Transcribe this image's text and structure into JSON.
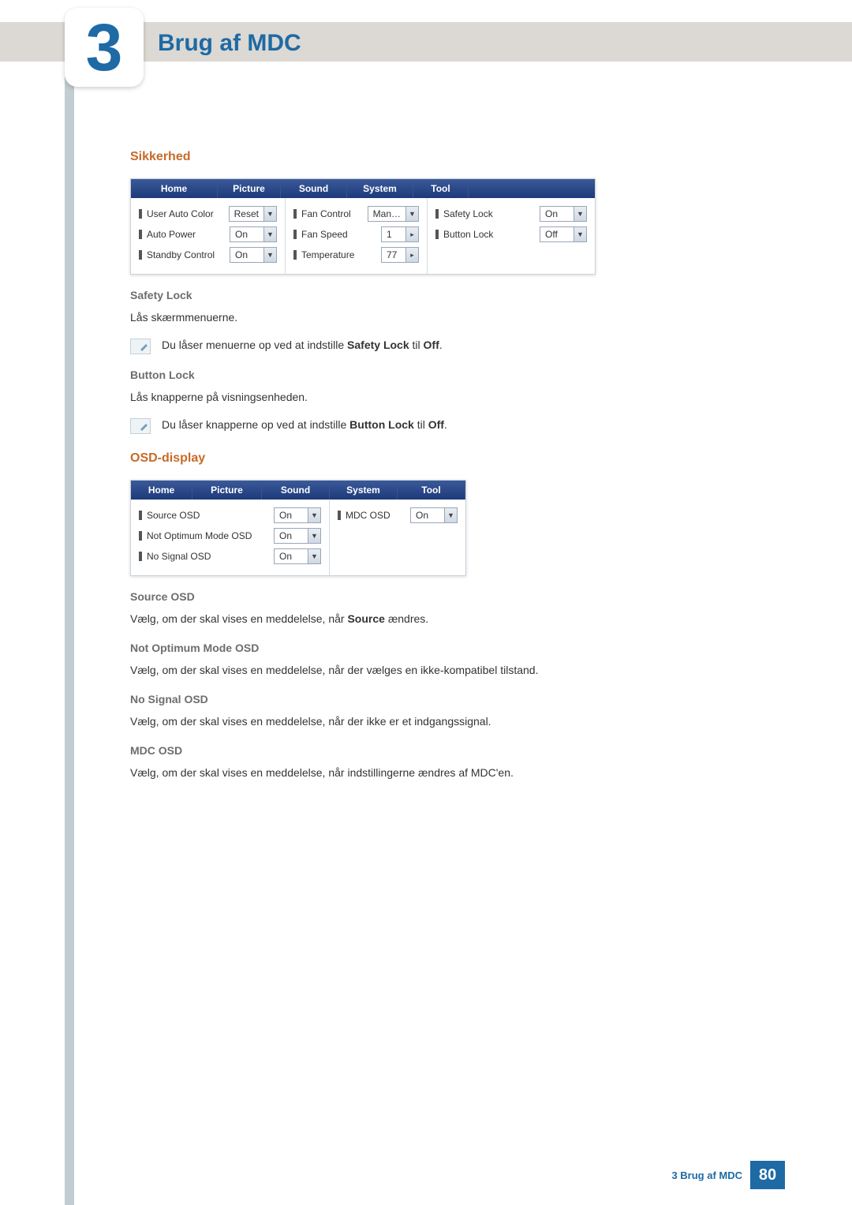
{
  "chapter": {
    "number": "3",
    "title": "Brug af MDC"
  },
  "sections": {
    "sikkerhed": {
      "title": "Sikkerhed",
      "tabs": [
        "Home",
        "Picture",
        "Sound",
        "System",
        "Tool"
      ],
      "cols": [
        {
          "fields": [
            {
              "label": "User Auto Color",
              "value": "Reset",
              "arrow": "▼"
            },
            {
              "label": "Auto Power",
              "value": "On",
              "arrow": "▼"
            },
            {
              "label": "Standby Control",
              "value": "On",
              "arrow": "▼"
            }
          ]
        },
        {
          "fields": [
            {
              "label": "Fan Control",
              "value": "Man…",
              "arrow": "▼"
            },
            {
              "label": "Fan Speed",
              "value": "1",
              "arrow": "▸"
            },
            {
              "label": "Temperature",
              "value": "77",
              "arrow": "▸"
            }
          ]
        },
        {
          "fields": [
            {
              "label": "Safety Lock",
              "value": "On",
              "arrow": "▼"
            },
            {
              "label": "Button Lock",
              "value": "Off",
              "arrow": "▼"
            }
          ]
        }
      ],
      "safety_lock": {
        "heading": "Safety Lock",
        "desc": "Lås skærmmenuerne.",
        "note_pre": "Du låser menuerne op ved at indstille ",
        "note_b1": "Safety Lock",
        "note_mid": " til ",
        "note_b2": "Off",
        "note_post": "."
      },
      "button_lock": {
        "heading": "Button Lock",
        "desc": "Lås knapperne på visningsenheden.",
        "note_pre": "Du låser knapperne op ved at indstille ",
        "note_b1": "Button Lock",
        "note_mid": " til ",
        "note_b2": "Off",
        "note_post": "."
      }
    },
    "osd": {
      "title": "OSD-display",
      "tabs": [
        "Home",
        "Picture",
        "Sound",
        "System",
        "Tool"
      ],
      "cols": [
        {
          "fields": [
            {
              "label": "Source OSD",
              "value": "On",
              "arrow": "▼"
            },
            {
              "label": "Not Optimum Mode OSD",
              "value": "On",
              "arrow": "▼"
            },
            {
              "label": "No Signal OSD",
              "value": "On",
              "arrow": "▼"
            }
          ]
        },
        {
          "fields": [
            {
              "label": "MDC OSD",
              "value": "On",
              "arrow": "▼"
            }
          ]
        }
      ],
      "source_osd": {
        "heading": "Source OSD",
        "desc_pre": "Vælg, om der skal vises en meddelelse, når ",
        "bold": "Source",
        "desc_post": " ændres."
      },
      "not_opt": {
        "heading": "Not Optimum Mode OSD",
        "desc": "Vælg, om der skal vises en meddelelse, når der vælges en ikke-kompatibel tilstand."
      },
      "no_signal": {
        "heading": "No Signal OSD",
        "desc": "Vælg, om der skal vises en meddelelse, når der ikke er et indgangssignal."
      },
      "mdc_osd": {
        "heading": "MDC OSD",
        "desc": "Vælg, om der skal vises en meddelelse, når indstillingerne ændres af MDC'en."
      }
    }
  },
  "footer": {
    "label": "3 Brug af MDC",
    "page": "80"
  }
}
